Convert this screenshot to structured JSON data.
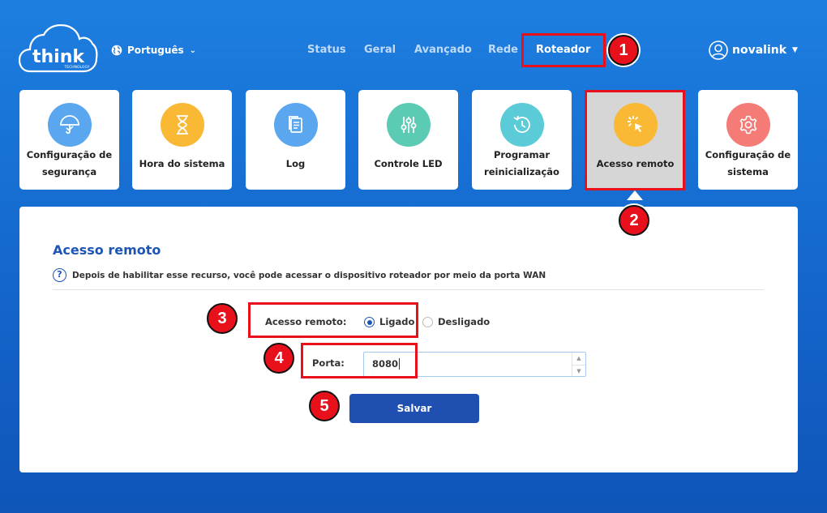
{
  "header": {
    "logo_text": "think",
    "logo_subtext": "TECHNOLOGY",
    "language": "Português",
    "username": "novalink"
  },
  "nav": [
    {
      "label": "Status"
    },
    {
      "label": "Geral"
    },
    {
      "label": "Avançado"
    },
    {
      "label": "Rede"
    },
    {
      "label": "Roteador",
      "active": true
    }
  ],
  "tiles": [
    {
      "label": "Configuração de segurança",
      "icon": "umbrella-icon",
      "color": "#5aa7f0"
    },
    {
      "label": "Hora do sistema",
      "icon": "hourglass-icon",
      "color": "#f9b935"
    },
    {
      "label": "Log",
      "icon": "document-icon",
      "color": "#5aa7f0"
    },
    {
      "label": "Controle LED",
      "icon": "sliders-icon",
      "color": "#5ccbb4"
    },
    {
      "label": "Programar reinicialização",
      "icon": "clock-restart-icon",
      "color": "#5ccbd8"
    },
    {
      "label": "Acesso remoto",
      "icon": "cursor-click-icon",
      "color": "#f9b935",
      "active": true
    },
    {
      "label": "Configuração de sistema",
      "icon": "gear-icon",
      "color": "#f47b76"
    }
  ],
  "panel": {
    "title": "Acesso remoto",
    "hint": "Depois de habilitar esse recurso, você pode acessar o dispositivo roteador por meio da porta WAN",
    "remote_access_label": "Acesso remoto:",
    "option_on": "Ligado",
    "option_off": "Desligado",
    "selected": "Ligado",
    "port_label": "Porta:",
    "port_value": "8080",
    "save_label": "Salvar"
  },
  "annotations": [
    "1",
    "2",
    "3",
    "4",
    "5"
  ],
  "colors": {
    "background": "#1a73d9",
    "accent": "#1e55b3",
    "annotation": "#e8101a"
  }
}
